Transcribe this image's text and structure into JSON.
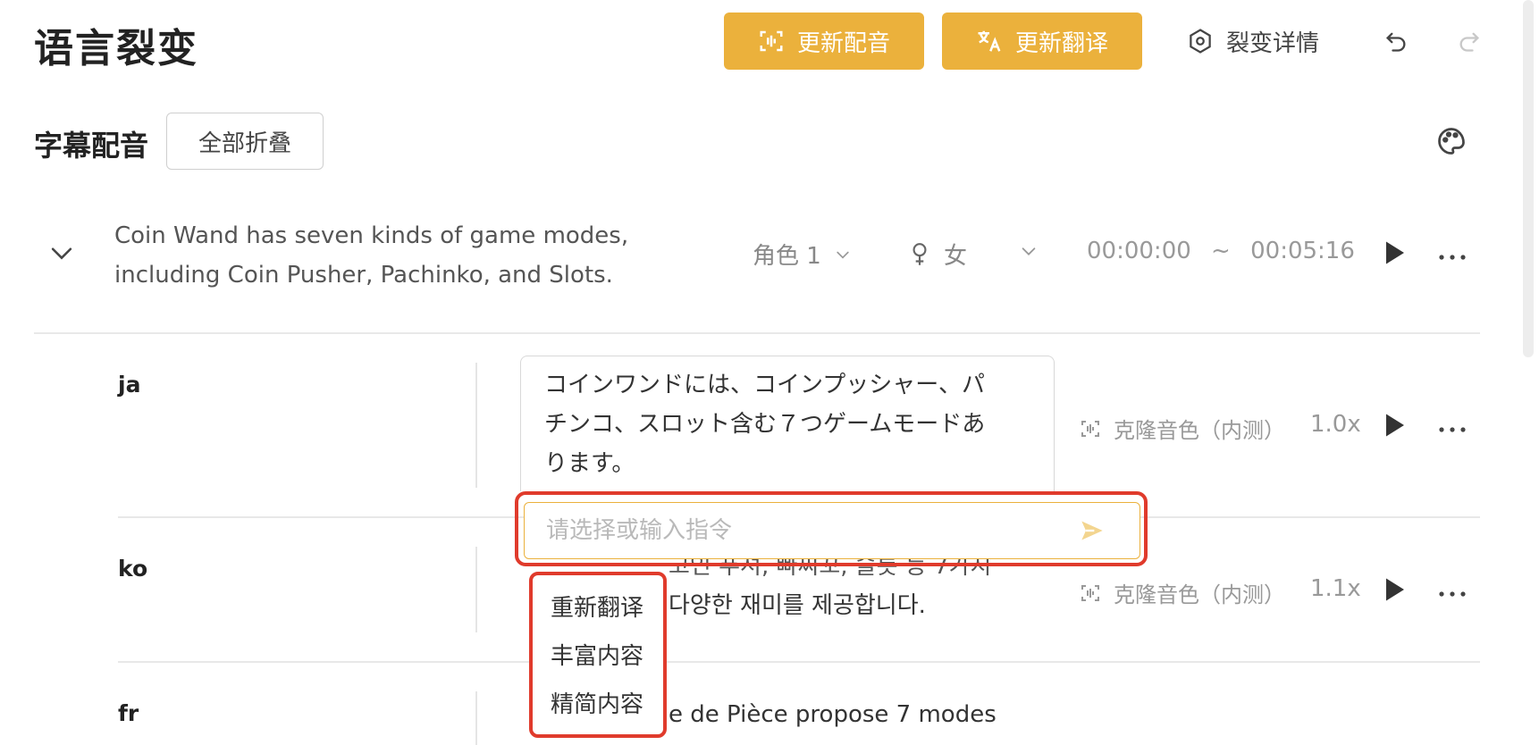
{
  "header": {
    "title": "语言裂变",
    "update_dub_label": "更新配音",
    "update_translation_label": "更新翻译",
    "detail_label": "裂变详情"
  },
  "section": {
    "title": "字幕配音",
    "collapse_all_label": "全部折叠"
  },
  "main_row": {
    "text_line1": "Coin Wand has seven kinds of game modes,",
    "text_line2": "including Coin Pusher, Pachinko, and Slots.",
    "role": "角色 1",
    "gender": "女",
    "start_time": "00:00:00",
    "time_sep": "~",
    "end_time": "00:05:16"
  },
  "rows": [
    {
      "code": "ja",
      "line1": "コインワンドには、コインプッシャー、パ",
      "line2": "チンコ、スロット含む７つゲームモードあ",
      "line3": "ります。",
      "voice": "克隆音色（内测）",
      "speed": "1.0x"
    },
    {
      "code": "ko",
      "line1": "고인 푸셔, 빠찌꼬, 슬롯 등 7가지",
      "line2": "다양한 재미를 제공합니다.",
      "voice": "克隆音色（内测）",
      "speed": "1.1x"
    },
    {
      "code": "fr",
      "line1": "e de Pièce propose 7 modes"
    }
  ],
  "command": {
    "placeholder": "请选择或输入指令",
    "options": [
      "重新翻译",
      "丰富内容",
      "精简内容"
    ]
  },
  "colors": {
    "primary": "#EBB13C",
    "highlight": "#E03B2C"
  }
}
